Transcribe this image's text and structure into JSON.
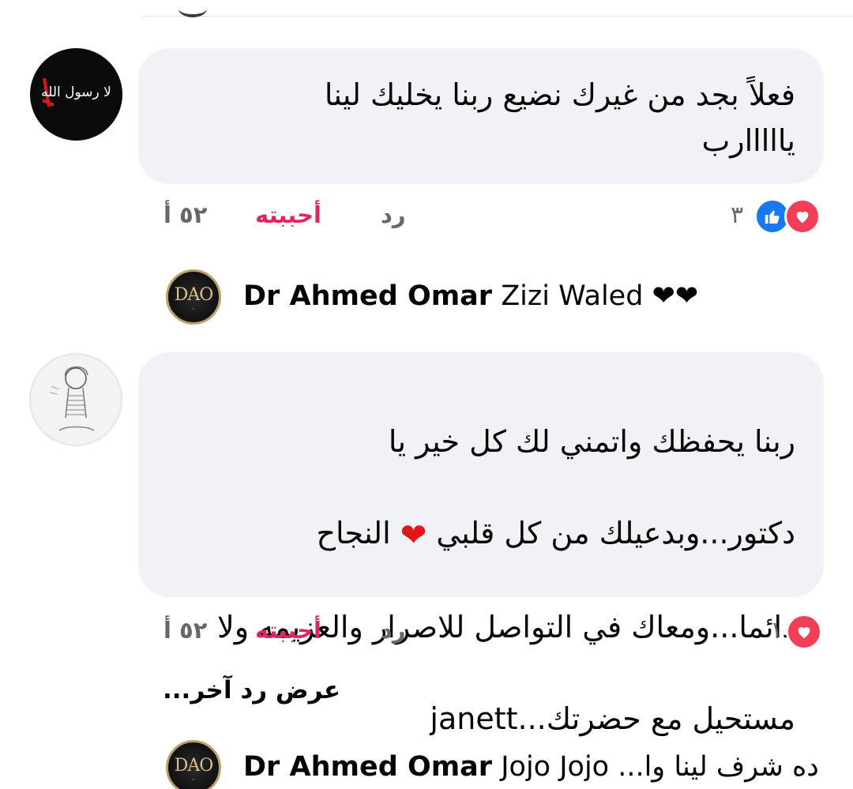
{
  "comments": [
    {
      "avatar_text": "لا رسول الله",
      "text": "فعلاً بجد من غيرك نضيع ربنا يخليك لينا\nيااااارب",
      "time": "٥٢ أ",
      "like_label": "أحببته",
      "reply_label": "رد",
      "reaction_count": "٣",
      "reaction_icons": [
        "like-icon",
        "love-icon"
      ]
    },
    {
      "text_lines": [
        "ربنا يحفظك واتمني لك كل خير يا",
        "دكتور...وبدعيلك من كل قلبي",
        "النجاح",
        "دائما...ومعاك في التواصل للاصرار والعزيمه ولا",
        "مستحيل مع حضرتك...janett"
      ],
      "emoji": "❤",
      "time": "٥٢ أ",
      "like_label": "أحببته",
      "reply_label": "رد",
      "reaction_count": "١",
      "reaction_icons": [
        "love-icon"
      ]
    }
  ],
  "replies": [
    {
      "avatar_text": "DAO",
      "author": "Dr Ahmed Omar",
      "text": "Zizi Waled ❤❤"
    },
    {
      "avatar_text": "DAO",
      "author": "Dr Ahmed Omar",
      "text": "Jojo Jojo ...ده شرف لينا وا"
    }
  ],
  "view_more_replies": "عرض رد آخر...",
  "colors": {
    "bubble": "#f0f2f5",
    "like_active": "#e0245e",
    "love": "#f33e58",
    "like": "#1877f2",
    "muted": "#65676b"
  }
}
